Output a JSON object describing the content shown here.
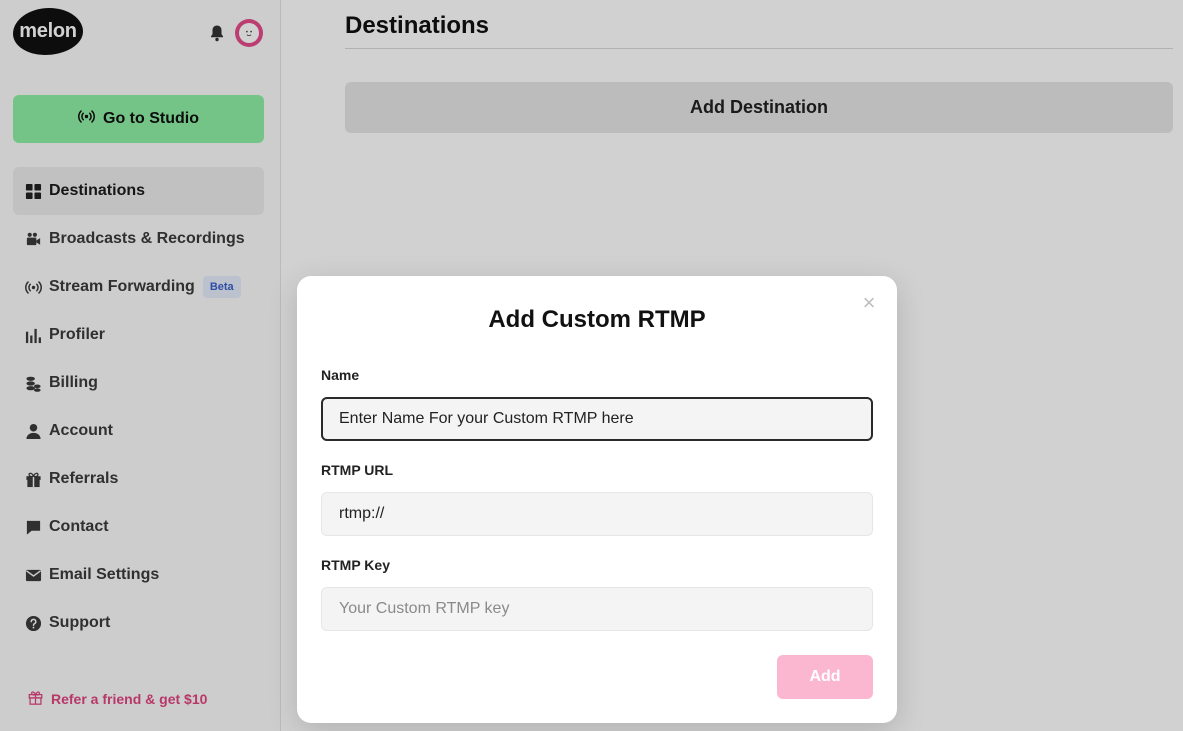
{
  "brand": {
    "logo_text": "melon",
    "accent": "#e54b8a",
    "studio_green": "#8ef0a6"
  },
  "header": {
    "notifications_icon": "bell-icon",
    "avatar_icon": "avatar"
  },
  "sidebar": {
    "studio_button": {
      "label": "Go to Studio",
      "icon": "broadcast-icon"
    },
    "items": [
      {
        "label": "Destinations",
        "icon": "grid-icon",
        "active": true
      },
      {
        "label": "Broadcasts & Recordings",
        "icon": "video-camera-icon"
      },
      {
        "label": "Stream Forwarding",
        "icon": "broadcast-icon",
        "badge": "Beta"
      },
      {
        "label": "Profiler",
        "icon": "bar-chart-icon"
      },
      {
        "label": "Billing",
        "icon": "coins-icon"
      },
      {
        "label": "Account",
        "icon": "user-icon"
      },
      {
        "label": "Referrals",
        "icon": "gift-icon"
      },
      {
        "label": "Contact",
        "icon": "chat-icon"
      },
      {
        "label": "Email Settings",
        "icon": "envelope-icon"
      },
      {
        "label": "Support",
        "icon": "help-icon"
      }
    ],
    "refer": {
      "label": "Refer a friend & get $10",
      "icon": "gift-icon"
    }
  },
  "main": {
    "title": "Destinations",
    "add_destination_label": "Add Destination"
  },
  "modal": {
    "title": "Add Custom RTMP",
    "close_icon": "close-icon",
    "name_label": "Name",
    "name_value": "Enter Name For your Custom RTMP here",
    "url_label": "RTMP URL",
    "url_value": "rtmp://",
    "key_label": "RTMP Key",
    "key_placeholder": "Your Custom RTMP key",
    "add_label": "Add"
  }
}
